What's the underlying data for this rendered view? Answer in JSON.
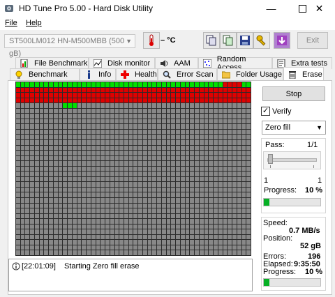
{
  "window": {
    "title": "HD Tune Pro 5.00 - Hard Disk Utility"
  },
  "menu": {
    "file": "File",
    "help": "Help"
  },
  "toolbar": {
    "drive": "ST500LM012 HN-M500MBB (500 gB)",
    "temperature": "– °C",
    "exit_label": "Exit"
  },
  "tabs_row1": [
    {
      "label": "File Benchmark",
      "icon": "file-benchmark-icon"
    },
    {
      "label": "Disk monitor",
      "icon": "disk-monitor-icon"
    },
    {
      "label": "AAM",
      "icon": "speaker-icon"
    },
    {
      "label": "Random Access",
      "icon": "random-access-icon"
    },
    {
      "label": "Extra tests",
      "icon": "extra-tests-icon"
    }
  ],
  "tabs_row2": [
    {
      "label": "Benchmark",
      "icon": "benchmark-icon"
    },
    {
      "label": "Info",
      "icon": "info-icon"
    },
    {
      "label": "Health",
      "icon": "health-icon"
    },
    {
      "label": "Error Scan",
      "icon": "magnifier-icon"
    },
    {
      "label": "Folder Usage",
      "icon": "folder-icon"
    },
    {
      "label": "Erase",
      "icon": "trash-icon",
      "active": true
    }
  ],
  "grid": {
    "columns": 50,
    "rows": 33,
    "colors": {
      "ok": "#00e000",
      "bad": "#e00000",
      "untested": "#888888"
    }
  },
  "log": {
    "time": "[22:01:09]",
    "message": "Starting Zero fill erase"
  },
  "controls": {
    "start_label": "Stop",
    "verify_label": "Verify",
    "verify_checked": true,
    "mode": "Zero fill"
  },
  "pass": {
    "label": "Pass:",
    "value": "1/1",
    "from": "1",
    "to": "1",
    "progress_label": "Progress:",
    "progress": "10 %",
    "progress_fraction": 0.1
  },
  "stats": {
    "speed_label": "Speed:",
    "speed": "0.7 MB/s",
    "position_label": "Position:",
    "position": "52 gB",
    "errors_label": "Errors:",
    "errors": "196",
    "elapsed_label": "Elapsed:",
    "elapsed": "9:35:50",
    "progress_label": "Progress:",
    "progress": "10 %",
    "progress_fraction": 0.1
  }
}
